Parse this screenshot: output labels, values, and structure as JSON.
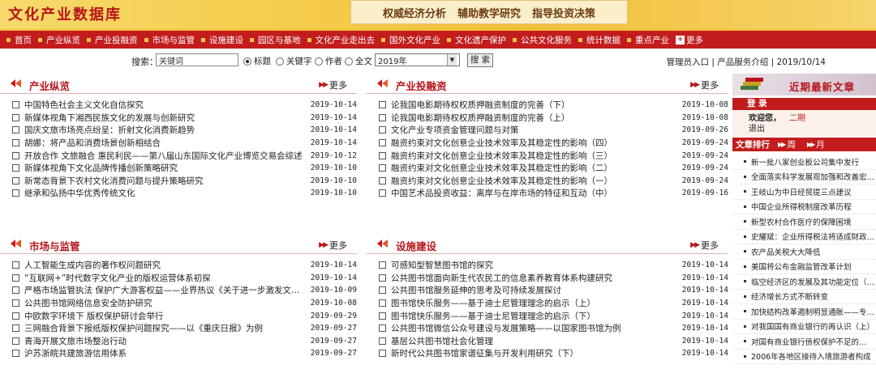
{
  "header": {
    "logo": "文化产业数据库",
    "slogans": [
      "权威经济分析",
      "辅助教学研究",
      "指导投资决策"
    ]
  },
  "nav": {
    "items": [
      "首页",
      "产业纵览",
      "产业投融资",
      "市场与监管",
      "设施建设",
      "园区与基地",
      "文化产业走出去",
      "国外文化产业",
      "文化遗产保护",
      "公共文化服务",
      "统计数据",
      "重点产业"
    ],
    "more": "更多"
  },
  "search": {
    "label": "搜索：",
    "value": "关键词",
    "options": [
      "标题",
      "关键字",
      "作者",
      "全文"
    ],
    "year": "2019年",
    "button": "搜 索",
    "admin": "管理员入口",
    "service": "产品服务介绍",
    "date": "2019/10/14"
  },
  "panels": [
    {
      "title": "产业纵览",
      "more": "更多",
      "items": [
        {
          "t": "中国特色社会主义文化自信探究",
          "d": "2019-10-14"
        },
        {
          "t": "新媒体视角下湘西民族文化的发展与创新研究",
          "d": "2019-10-14"
        },
        {
          "t": "国庆文旅市场亮点纷呈：折射文化消费新趋势",
          "d": "2019-10-14"
        },
        {
          "t": "胡娜：将产品和消费场景创新相结合",
          "d": "2019-10-14"
        },
        {
          "t": "开放合作 文旅融合 惠民利民——第八届山东国际文化产业博览交易会综述",
          "d": "2019-10-12"
        },
        {
          "t": "新媒体视角下文化品牌传播创新策略研究",
          "d": "2019-10-10"
        },
        {
          "t": "新常态背景下农村文化消费问题与提升策略研究",
          "d": "2019-10-10"
        },
        {
          "t": "继承和弘扬中华优秀传统文化",
          "d": "2019-10-10"
        }
      ]
    },
    {
      "title": "产业投融资",
      "more": "更多",
      "items": [
        {
          "t": "论我国电影期待权权质押融资制度的完善（下）",
          "d": "2019-10-08"
        },
        {
          "t": "论我国电影期待权权质押融资制度的完善（上）",
          "d": "2019-10-08"
        },
        {
          "t": "文化产业专项资金管理问题与对策",
          "d": "2019-09-26"
        },
        {
          "t": "融资约束对文化创意企业技术效率及其稳定性的影响（四）",
          "d": "2019-09-24"
        },
        {
          "t": "融资约束对文化创意企业技术效率及其稳定性的影响（三）",
          "d": "2019-09-24"
        },
        {
          "t": "融资约束对文化创意企业技术效率及其稳定性的影响（二）",
          "d": "2019-09-24"
        },
        {
          "t": "融资约束对文化创意企业技术效率及其稳定性的影响（一）",
          "d": "2019-09-24"
        },
        {
          "t": "中国艺术品投资收益：离岸与在岸市场的特征和互动（中）",
          "d": "2019-09-16"
        }
      ]
    },
    {
      "title": "市场与监管",
      "more": "更多",
      "items": [
        {
          "t": "人工智能生成内容的著作权问题研究",
          "d": "2019-10-14"
        },
        {
          "t": "“互联网+”时代数字文化产业的版权运营体系初探",
          "d": "2019-10-14"
        },
        {
          "t": "严格市场监管执法 保护广大游客权益——业界热议《关于进一步激发文…",
          "d": "2019-10-09"
        },
        {
          "t": "公共图书馆网络信息安全防护研究",
          "d": "2019-10-08"
        },
        {
          "t": "中欧数字环境下 版权保护研讨会举行",
          "d": "2019-09-29"
        },
        {
          "t": "三网融合背景下报纸版权保护问题探究——以《重庆日报》为例",
          "d": "2019-09-27"
        },
        {
          "t": "青海开展文旅市场整治行动",
          "d": "2019-09-27"
        },
        {
          "t": "沪苏浙皖共建旅游信用体系",
          "d": "2019-09-27"
        }
      ]
    },
    {
      "title": "设施建设",
      "more": "更多",
      "items": [
        {
          "t": "可感知型智慧图书馆的探究",
          "d": "2019-10-14"
        },
        {
          "t": "公共图书馆面向新生代农民工的信息素养教育体系构建研究",
          "d": "2019-10-14"
        },
        {
          "t": "公共图书馆服务延伸的思考及可持续发展探讨",
          "d": "2019-10-14"
        },
        {
          "t": "图书馆快乐服务——基于迪士尼管理理念的启示（上）",
          "d": "2019-10-14"
        },
        {
          "t": "图书馆快乐服务——基于迪士尼管理理念的启示（下）",
          "d": "2019-10-14"
        },
        {
          "t": "公共图书馆微信公众号建设与发展策略——以国家图书馆为例",
          "d": "2019-10-14"
        },
        {
          "t": "基层公共图书馆社会化管理",
          "d": "2019-10-14"
        },
        {
          "t": "新时代公共图书馆家谱征集与开发利用研究（下）",
          "d": "2019-10-14"
        }
      ]
    }
  ],
  "right": {
    "banner": "近期最新文章",
    "login_bar": "登 录",
    "welcome": "欢迎您，",
    "user": "二期",
    "logout": "退出",
    "rank_label": "文章排行",
    "tabs": [
      "周",
      "月"
    ],
    "items": [
      "新一批八家创业板公司集中发行",
      "全面落实科学发展观加强和改善宏…",
      "王岐山为中日经贸提三点建议",
      "中国企业所得税制度改革历程",
      "新型农村合作医疗的保障困境",
      "史耀斌：企业所得税法将适成财政…",
      "农产品关税大大降低",
      "美国将公布金融监管改革计划",
      "临空经济区的发展及其功能定位（…",
      "经济增长方式不断转变",
      "加快结构改革遏制明显通胀——专…",
      "对我国国有商业银行的再认识（上）",
      "对国有商业银行债权保护不足的…",
      "2006年各地区接待入境旅游者构成"
    ]
  },
  "colors": {
    "brand_red": "#c21d1c",
    "title_red": "#b8141a",
    "header_gold": "#f1bf3a"
  },
  "icons": [
    "panel-header-icon",
    "double-arrow-icon",
    "checkbox-icon",
    "bullet-dot-icon",
    "book-stack-icon"
  ]
}
